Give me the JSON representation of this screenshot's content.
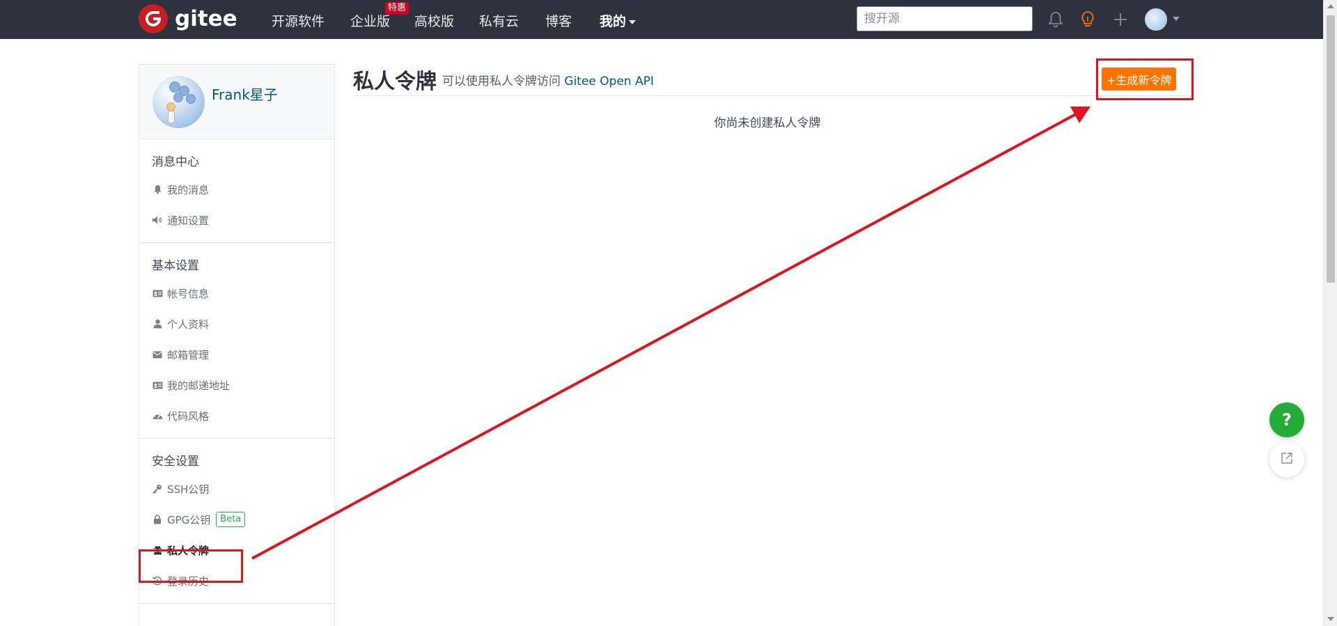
{
  "header": {
    "logo_text": "gitee",
    "nav_items": [
      "开源软件",
      "企业版",
      "高校版",
      "私有云",
      "博客",
      "我的"
    ],
    "enterprise_badge": "特惠",
    "search_placeholder": "搜开源",
    "accent_color": "#fe7300",
    "brand_color": "#c71d23",
    "icons": [
      "bell-icon",
      "lightbulb-icon",
      "plus-icon",
      "avatar",
      "chevron-down-icon"
    ]
  },
  "sidebar": {
    "username": "Frank星子",
    "sections": [
      {
        "title": "消息中心",
        "items": [
          {
            "label": "我的消息",
            "icon": "bell-icon"
          },
          {
            "label": "通知设置",
            "icon": "speaker-icon"
          }
        ]
      },
      {
        "title": "基本设置",
        "items": [
          {
            "label": "帐号信息",
            "icon": "id-card-icon"
          },
          {
            "label": "个人资料",
            "icon": "user-icon"
          },
          {
            "label": "邮箱管理",
            "icon": "envelope-icon"
          },
          {
            "label": "我的邮递地址",
            "icon": "address-card-icon"
          },
          {
            "label": "代码风格",
            "icon": "dashboard-icon"
          }
        ]
      },
      {
        "title": "安全设置",
        "items": [
          {
            "label": "SSH公钥",
            "icon": "key-icon"
          },
          {
            "label": "GPG公钥",
            "icon": "lock-icon",
            "badge": "Beta"
          },
          {
            "label": "私人令牌",
            "icon": "user-secret-icon",
            "active": true
          },
          {
            "label": "登录历史",
            "icon": "history-icon"
          }
        ]
      }
    ]
  },
  "main": {
    "title": "私人令牌",
    "subtitle_prefix": "可以使用私人令牌访问",
    "subtitle_link": "Gitee Open API",
    "new_token_button": "+生成新令牌",
    "empty_message": "你尚未创建私人令牌"
  },
  "floating": {
    "help_label": "?",
    "help_color": "#22ac38"
  },
  "annotation": {
    "highlight_color": "#e0141c"
  }
}
